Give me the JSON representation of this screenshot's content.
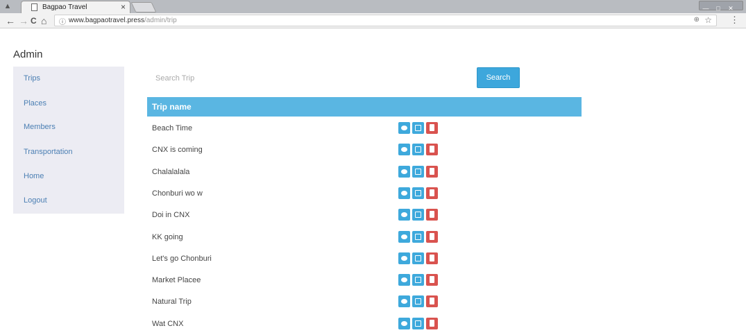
{
  "browser": {
    "tab_title": "Bagpao Travel",
    "tab_close": "×",
    "url_host": "www.bagpaotravel.press",
    "url_path": "/admin/trip",
    "nav": {
      "back": "←",
      "forward": "→",
      "reload": "C",
      "home": "⌂"
    },
    "info_icon": "ⓘ",
    "zoom_icon": "⊕",
    "bookmark_icon": "☆",
    "menu_icon": "⋮",
    "window_controls": [
      "—",
      "□",
      "✕"
    ]
  },
  "page": {
    "title": "Admin"
  },
  "sidebar": {
    "items": [
      {
        "label": "Trips"
      },
      {
        "label": "Places"
      },
      {
        "label": "Members"
      },
      {
        "label": "Transportation"
      },
      {
        "label": "Home"
      },
      {
        "label": "Logout"
      }
    ]
  },
  "search": {
    "placeholder": "Search Trip",
    "value": "",
    "button_label": "Search"
  },
  "table": {
    "column_header": "Trip name",
    "rows": [
      {
        "name": "Beach Time"
      },
      {
        "name": "CNX is coming"
      },
      {
        "name": "Chalalalala"
      },
      {
        "name": "Chonburi wo w"
      },
      {
        "name": "Doi in CNX"
      },
      {
        "name": "KK going"
      },
      {
        "name": "Let's go Chonburi"
      },
      {
        "name": "Market Placee"
      },
      {
        "name": "Natural Trip"
      },
      {
        "name": "Wat CNX"
      }
    ],
    "action_icons": [
      "eye-icon",
      "edit-icon",
      "trash-icon"
    ]
  },
  "colors": {
    "header_bg": "#5ab6e2",
    "view_edit_btn": "#3ea9dc",
    "delete_btn": "#d9534f",
    "sidebar_bg": "#ececf3",
    "sidebar_link": "#4b7fb3"
  }
}
